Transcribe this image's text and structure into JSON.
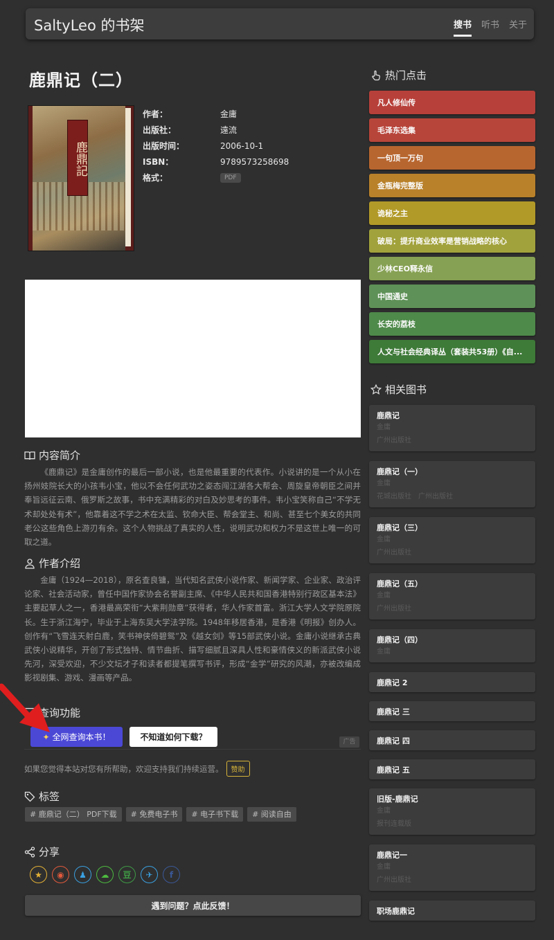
{
  "header": {
    "brand": "SaltyLeo 的书架",
    "nav": [
      "搜书",
      "听书",
      "关于"
    ],
    "active": 0
  },
  "book": {
    "title": "鹿鼎记（二）",
    "cover_text": "鹿鼎記",
    "meta": [
      {
        "label": "作者：",
        "value": "金庸"
      },
      {
        "label": "出版社：",
        "value": "遠流"
      },
      {
        "label": "出版时间：",
        "value": "2006-10-1"
      },
      {
        "label": "ISBN：",
        "value": "9789573258698"
      },
      {
        "label": "格式：",
        "value": "PDF"
      }
    ]
  },
  "intro": {
    "heading": "内容简介",
    "text": "《鹿鼎记》是金庸创作的最后一部小说，也是他最重要的代表作。小说讲的是一个从小在扬州妓院长大的小孩韦小宝，他以不会任何武功之姿态闯江湖各大帮会、周旋皇帝朝臣之间并奉旨远征云南、俄罗斯之故事，书中充满精彩的对白及妙思考的事件。韦小宝笑称自己“不学无术却处处有术”，他靠着这不学之术在太监、钦命大臣、帮会堂主、和尚、甚至七个美女的共同老公这些角色上游刃有余。这个人物挑战了真实的人性，说明武功和权力不是这世上唯一的可取之道。"
  },
  "author": {
    "heading": "作者介绍",
    "text": "金庸（1924—2018），原名查良镛，当代知名武侠小说作家、新闻学家、企业家、政治评论家、社会活动家，曾任中国作家协会名誉副主席、《中华人民共和国香港特别行政区基本法》主要起草人之一，香港最高荣衔“大紫荆勋章”获得者，华人作家首富。浙江大学人文学院原院长。生于浙江海宁，毕业于上海东吴大学法学院。1948年移居香港，是香港《明报》创办人。创作有“飞雪连天射白鹿，笑书神侠倚碧鸳”及《越女剑》等15部武侠小说。金庸小说继承古典武侠小说精华，开创了形式独特、情节曲折、描写细腻且深具人性和豪情侠义的新派武侠小说先河，深受欢迎，不少文坛才子和读者都提笔撰写书评，形成“金学”研究的风潮，亦被改编成影视剧集、游戏、漫画等产品。"
  },
  "query": {
    "heading": "查询功能",
    "search_btn": "全网查询本书！",
    "help_btn": "不知道如何下载？",
    "ad_label": "广告",
    "support_text": "如果您觉得本站对您有所帮助，欢迎支持我们持续运营。",
    "support_btn": "赞助"
  },
  "tags": {
    "heading": "标签",
    "items": [
      "# 鹿鼎记（二） PDF下载",
      "# 免费电子书",
      "# 电子书下载",
      "# 阅读自由"
    ]
  },
  "share": {
    "heading": "分享",
    "icons": [
      {
        "name": "qzone-icon",
        "glyph": "★",
        "color": "#e5b236"
      },
      {
        "name": "weibo-icon",
        "glyph": "◉",
        "color": "#e35a3c"
      },
      {
        "name": "qq-icon",
        "glyph": "♟",
        "color": "#3aa0e0"
      },
      {
        "name": "wechat-icon",
        "glyph": "☁",
        "color": "#4dbb3f"
      },
      {
        "name": "douban-icon",
        "glyph": "豆",
        "color": "#3f9b45"
      },
      {
        "name": "twitter-icon",
        "glyph": "✈",
        "color": "#3aa0e0"
      },
      {
        "name": "facebook-icon",
        "glyph": "f",
        "color": "#3b5998"
      }
    ]
  },
  "feedback": "遇到问题？点此反馈！",
  "hot": {
    "heading": "热门点击",
    "items": [
      {
        "title": "凡人修仙传",
        "color": "#b8403a"
      },
      {
        "title": "毛泽东选集",
        "color": "#b8453a"
      },
      {
        "title": "一句顶一万句",
        "color": "#b8662f"
      },
      {
        "title": "金瓶梅完整版",
        "color": "#b9812a"
      },
      {
        "title": "诡秘之主",
        "color": "#b29a28"
      },
      {
        "title": "破局：提升商业效率是营销战略的核心",
        "color": "#a2a23c"
      },
      {
        "title": "少林CEO释永信",
        "color": "#86a153"
      },
      {
        "title": "中国通史",
        "color": "#5e9157"
      },
      {
        "title": "长安的荔枝",
        "color": "#4e8a4a"
      },
      {
        "title": "人文与社会经典译丛（套装共53册）《自...",
        "color": "#3e7a38"
      }
    ]
  },
  "related": {
    "heading": "相关图书",
    "items": [
      {
        "title": "鹿鼎记",
        "author": "金庸",
        "publishers": [
          "广州出版社"
        ]
      },
      {
        "title": "鹿鼎记（一）",
        "author": "金庸",
        "publishers": [
          "花城出版社",
          "广州出版社"
        ]
      },
      {
        "title": "鹿鼎记（三）",
        "author": "金庸",
        "publishers": [
          "广州出版社"
        ]
      },
      {
        "title": "鹿鼎记（五）",
        "author": "金庸",
        "publishers": [
          "广州出版社"
        ]
      },
      {
        "title": "鹿鼎记（四）",
        "author": "金庸",
        "publishers": []
      },
      {
        "title": "鹿鼎记 2",
        "author": "",
        "publishers": []
      },
      {
        "title": "鹿鼎记 三",
        "author": "",
        "publishers": []
      },
      {
        "title": "鹿鼎记 四",
        "author": "",
        "publishers": []
      },
      {
        "title": "鹿鼎记 五",
        "author": "",
        "publishers": []
      },
      {
        "title": "旧版-鹿鼎记",
        "author": "金庸",
        "publishers": [
          "报刊连载版"
        ]
      },
      {
        "title": "鹿鼎记一",
        "author": "金庸",
        "publishers": [
          "广州出版社"
        ]
      },
      {
        "title": "职场鹿鼎记",
        "author": "",
        "publishers": []
      }
    ]
  }
}
